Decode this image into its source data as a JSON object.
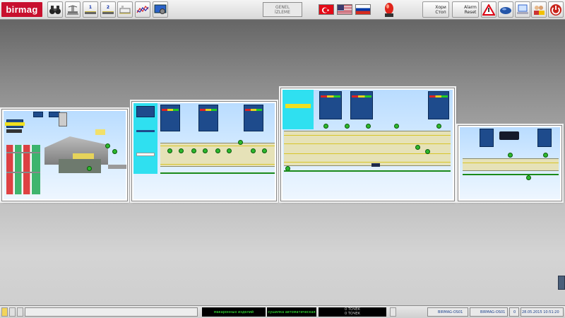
{
  "app": {
    "brand": "birmag",
    "overview_line1": "GENEL",
    "overview_line2": "İZLEME"
  },
  "toolbar": {
    "line1_label": "1",
    "line2_label": "2",
    "stop_label_1": "Хори",
    "stop_label_2": "Стоп",
    "alarm_label_1": "Alarm",
    "alarm_label_2": "Reset"
  },
  "status": {
    "product": "макаронных изделий",
    "mode": "сушилка автоматическая",
    "field1": "0 ТОЧЕК",
    "field2": "0 ТОЧЕК",
    "station1": "BIRMAG-OS01",
    "station2": "BIRMAG-OS01",
    "counter": "0",
    "datetime": "28.05.2015 10:51:20"
  },
  "colors": {
    "brand": "#c8102e",
    "panel_blue": "#1e4b8c",
    "cyan": "#2fe0f0",
    "motor_green": "#2db82d",
    "status_green": "#3cff3c"
  }
}
